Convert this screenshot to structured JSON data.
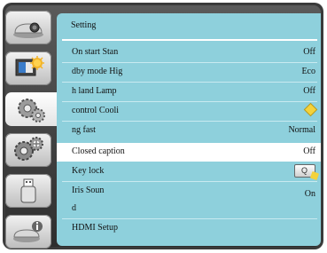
{
  "panel": {
    "title": "Setting"
  },
  "sidebar": {
    "items": [
      {
        "icon": "projector-icon"
      },
      {
        "icon": "image-adjust-icon"
      },
      {
        "icon": "setting-gears-icon"
      },
      {
        "icon": "extended-gears-icon"
      },
      {
        "icon": "usb-memory-icon"
      },
      {
        "icon": "info-icon"
      }
    ]
  },
  "menu": {
    "rows": [
      {
        "label": "On start  Stan",
        "value": "Off"
      },
      {
        "label": "dby mode  Hig",
        "value": "Eco"
      },
      {
        "label": "h land  Lamp",
        "value": "Off"
      },
      {
        "label": "control  Cooli",
        "value": ""
      },
      {
        "label": "ng fast",
        "value": "Normal"
      },
      {
        "label": "Closed caption",
        "value": "Off"
      },
      {
        "label": "Key lock",
        "value": ""
      },
      {
        "label": "Iris  Soun",
        "value": "On"
      },
      {
        "label": "d",
        "value": ""
      },
      {
        "label": "HDMI Setup",
        "value": ""
      }
    ],
    "keylock_glyph": "Q"
  },
  "colors": {
    "panel_bg": "#8ed0dc",
    "selected_row": "#ffffff",
    "frame": "#3a3a3a",
    "accent": "#f4d23a"
  }
}
